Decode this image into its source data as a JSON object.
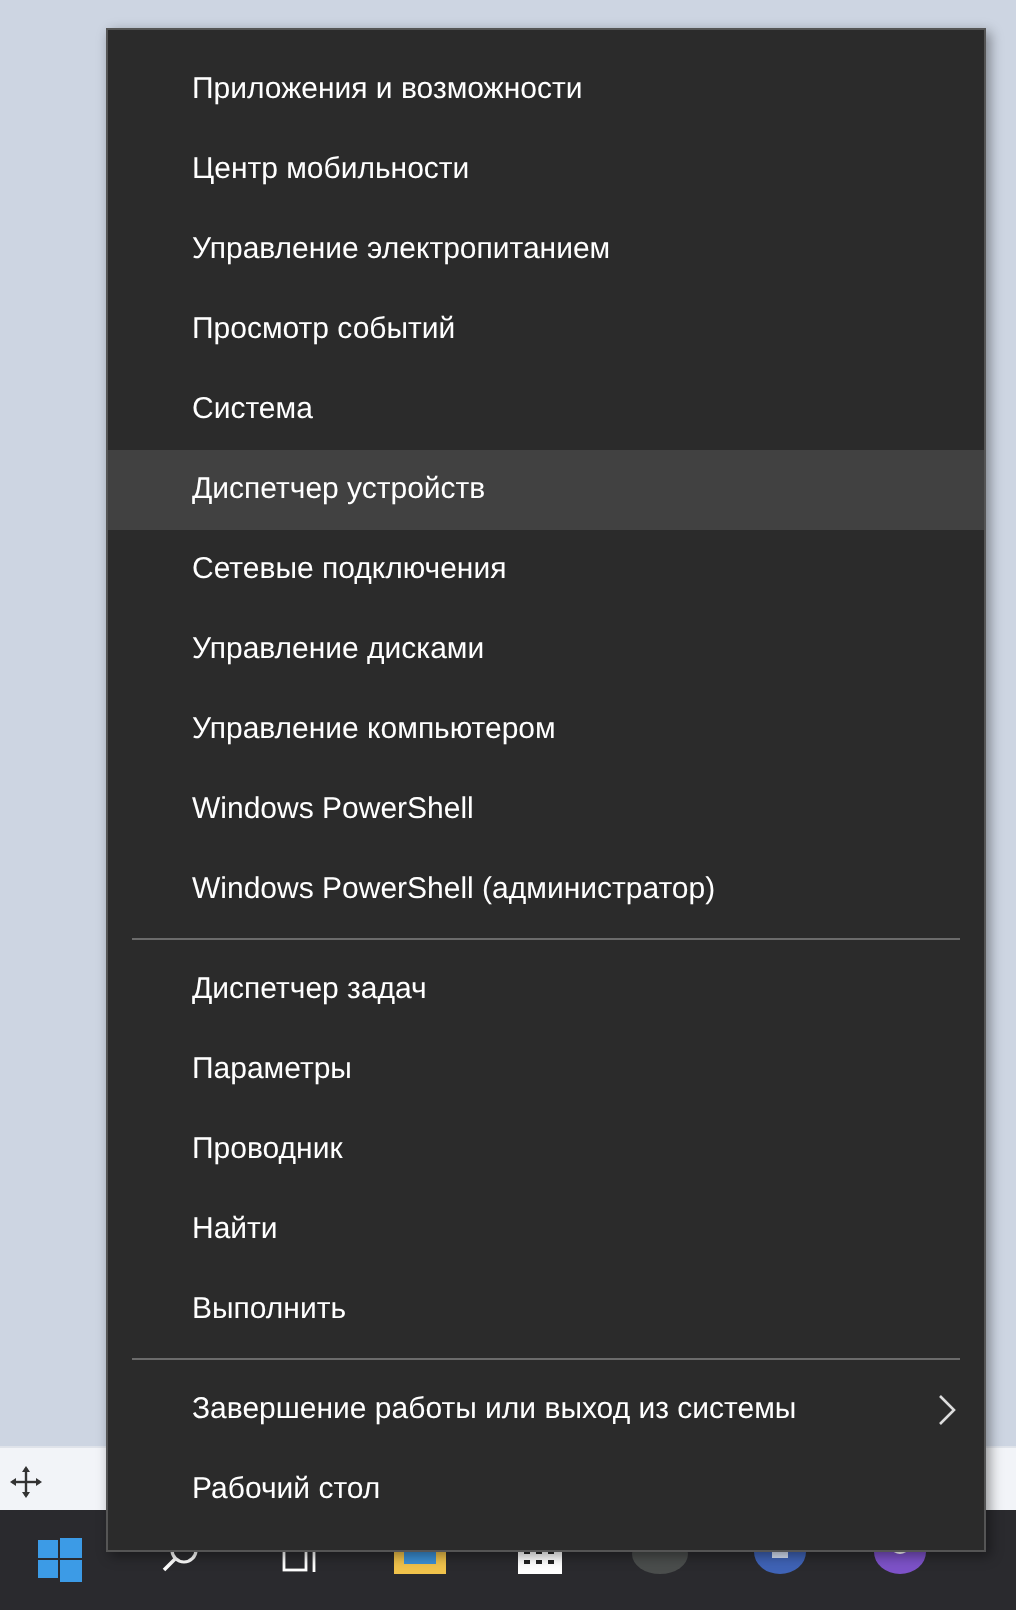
{
  "context_menu": {
    "items": [
      {
        "kind": "item",
        "label": "Приложения и возможности",
        "selected": false
      },
      {
        "kind": "item",
        "label": "Центр мобильности",
        "selected": false
      },
      {
        "kind": "item",
        "label": "Управление электропитанием",
        "selected": false
      },
      {
        "kind": "item",
        "label": "Просмотр событий",
        "selected": false
      },
      {
        "kind": "item",
        "label": "Система",
        "selected": false
      },
      {
        "kind": "item",
        "label": "Диспетчер устройств",
        "selected": true
      },
      {
        "kind": "item",
        "label": "Сетевые подключения",
        "selected": false
      },
      {
        "kind": "item",
        "label": "Управление дисками",
        "selected": false
      },
      {
        "kind": "item",
        "label": "Управление компьютером",
        "selected": false
      },
      {
        "kind": "item",
        "label": "Windows PowerShell",
        "selected": false
      },
      {
        "kind": "item",
        "label": "Windows PowerShell (администратор)",
        "selected": false
      },
      {
        "kind": "separator"
      },
      {
        "kind": "item",
        "label": "Диспетчер задач",
        "selected": false
      },
      {
        "kind": "item",
        "label": "Параметры",
        "selected": false
      },
      {
        "kind": "item",
        "label": "Проводник",
        "selected": false
      },
      {
        "kind": "item",
        "label": "Найти",
        "selected": false
      },
      {
        "kind": "item",
        "label": "Выполнить",
        "selected": false
      },
      {
        "kind": "separator"
      },
      {
        "kind": "item",
        "label": "Завершение работы или выход из системы",
        "selected": false,
        "submenu": true
      },
      {
        "kind": "item",
        "label": "Рабочий стол",
        "selected": false
      }
    ]
  }
}
